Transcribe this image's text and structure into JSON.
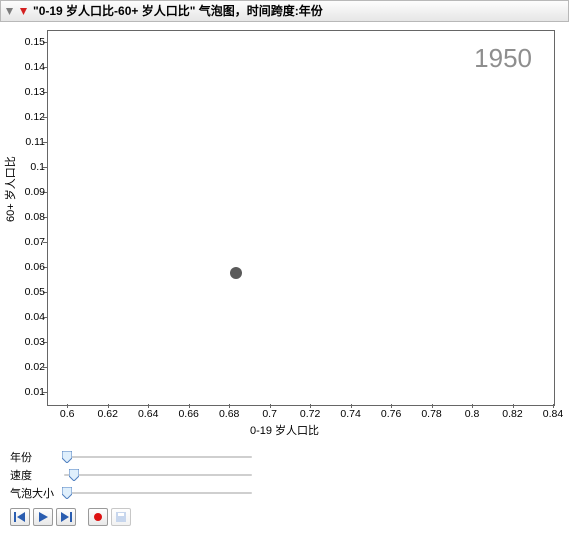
{
  "header": {
    "title": "\"0-19 岁人口比-60+ 岁人口比\" 气泡图，时间跨度:年份"
  },
  "chart_data": {
    "type": "scatter",
    "annotation": "1950",
    "xlabel": "0-19 岁人口比",
    "ylabel": "60+ 岁人口比",
    "xlim": [
      0.59,
      0.84
    ],
    "ylim": [
      0.005,
      0.155
    ],
    "xticks": [
      0.6,
      0.62,
      0.64,
      0.66,
      0.68,
      0.7,
      0.72,
      0.74,
      0.76,
      0.78,
      0.8,
      0.82,
      0.84
    ],
    "yticks": [
      0.01,
      0.02,
      0.03,
      0.04,
      0.05,
      0.06,
      0.07,
      0.08,
      0.09,
      0.1,
      0.11,
      0.12,
      0.13,
      0.14,
      0.15
    ],
    "series": [
      {
        "name": "bubble",
        "points": [
          {
            "x": 0.683,
            "y": 0.058
          }
        ]
      }
    ]
  },
  "controls": {
    "year": {
      "label": "年份",
      "pos": 0.02
    },
    "speed": {
      "label": "速度",
      "pos": 0.06
    },
    "size": {
      "label": "气泡大小",
      "pos": 0.02
    }
  },
  "buttons": {
    "step_back": "step-back",
    "play": "play",
    "step_fwd": "step-forward",
    "record": "record",
    "save": "save"
  }
}
